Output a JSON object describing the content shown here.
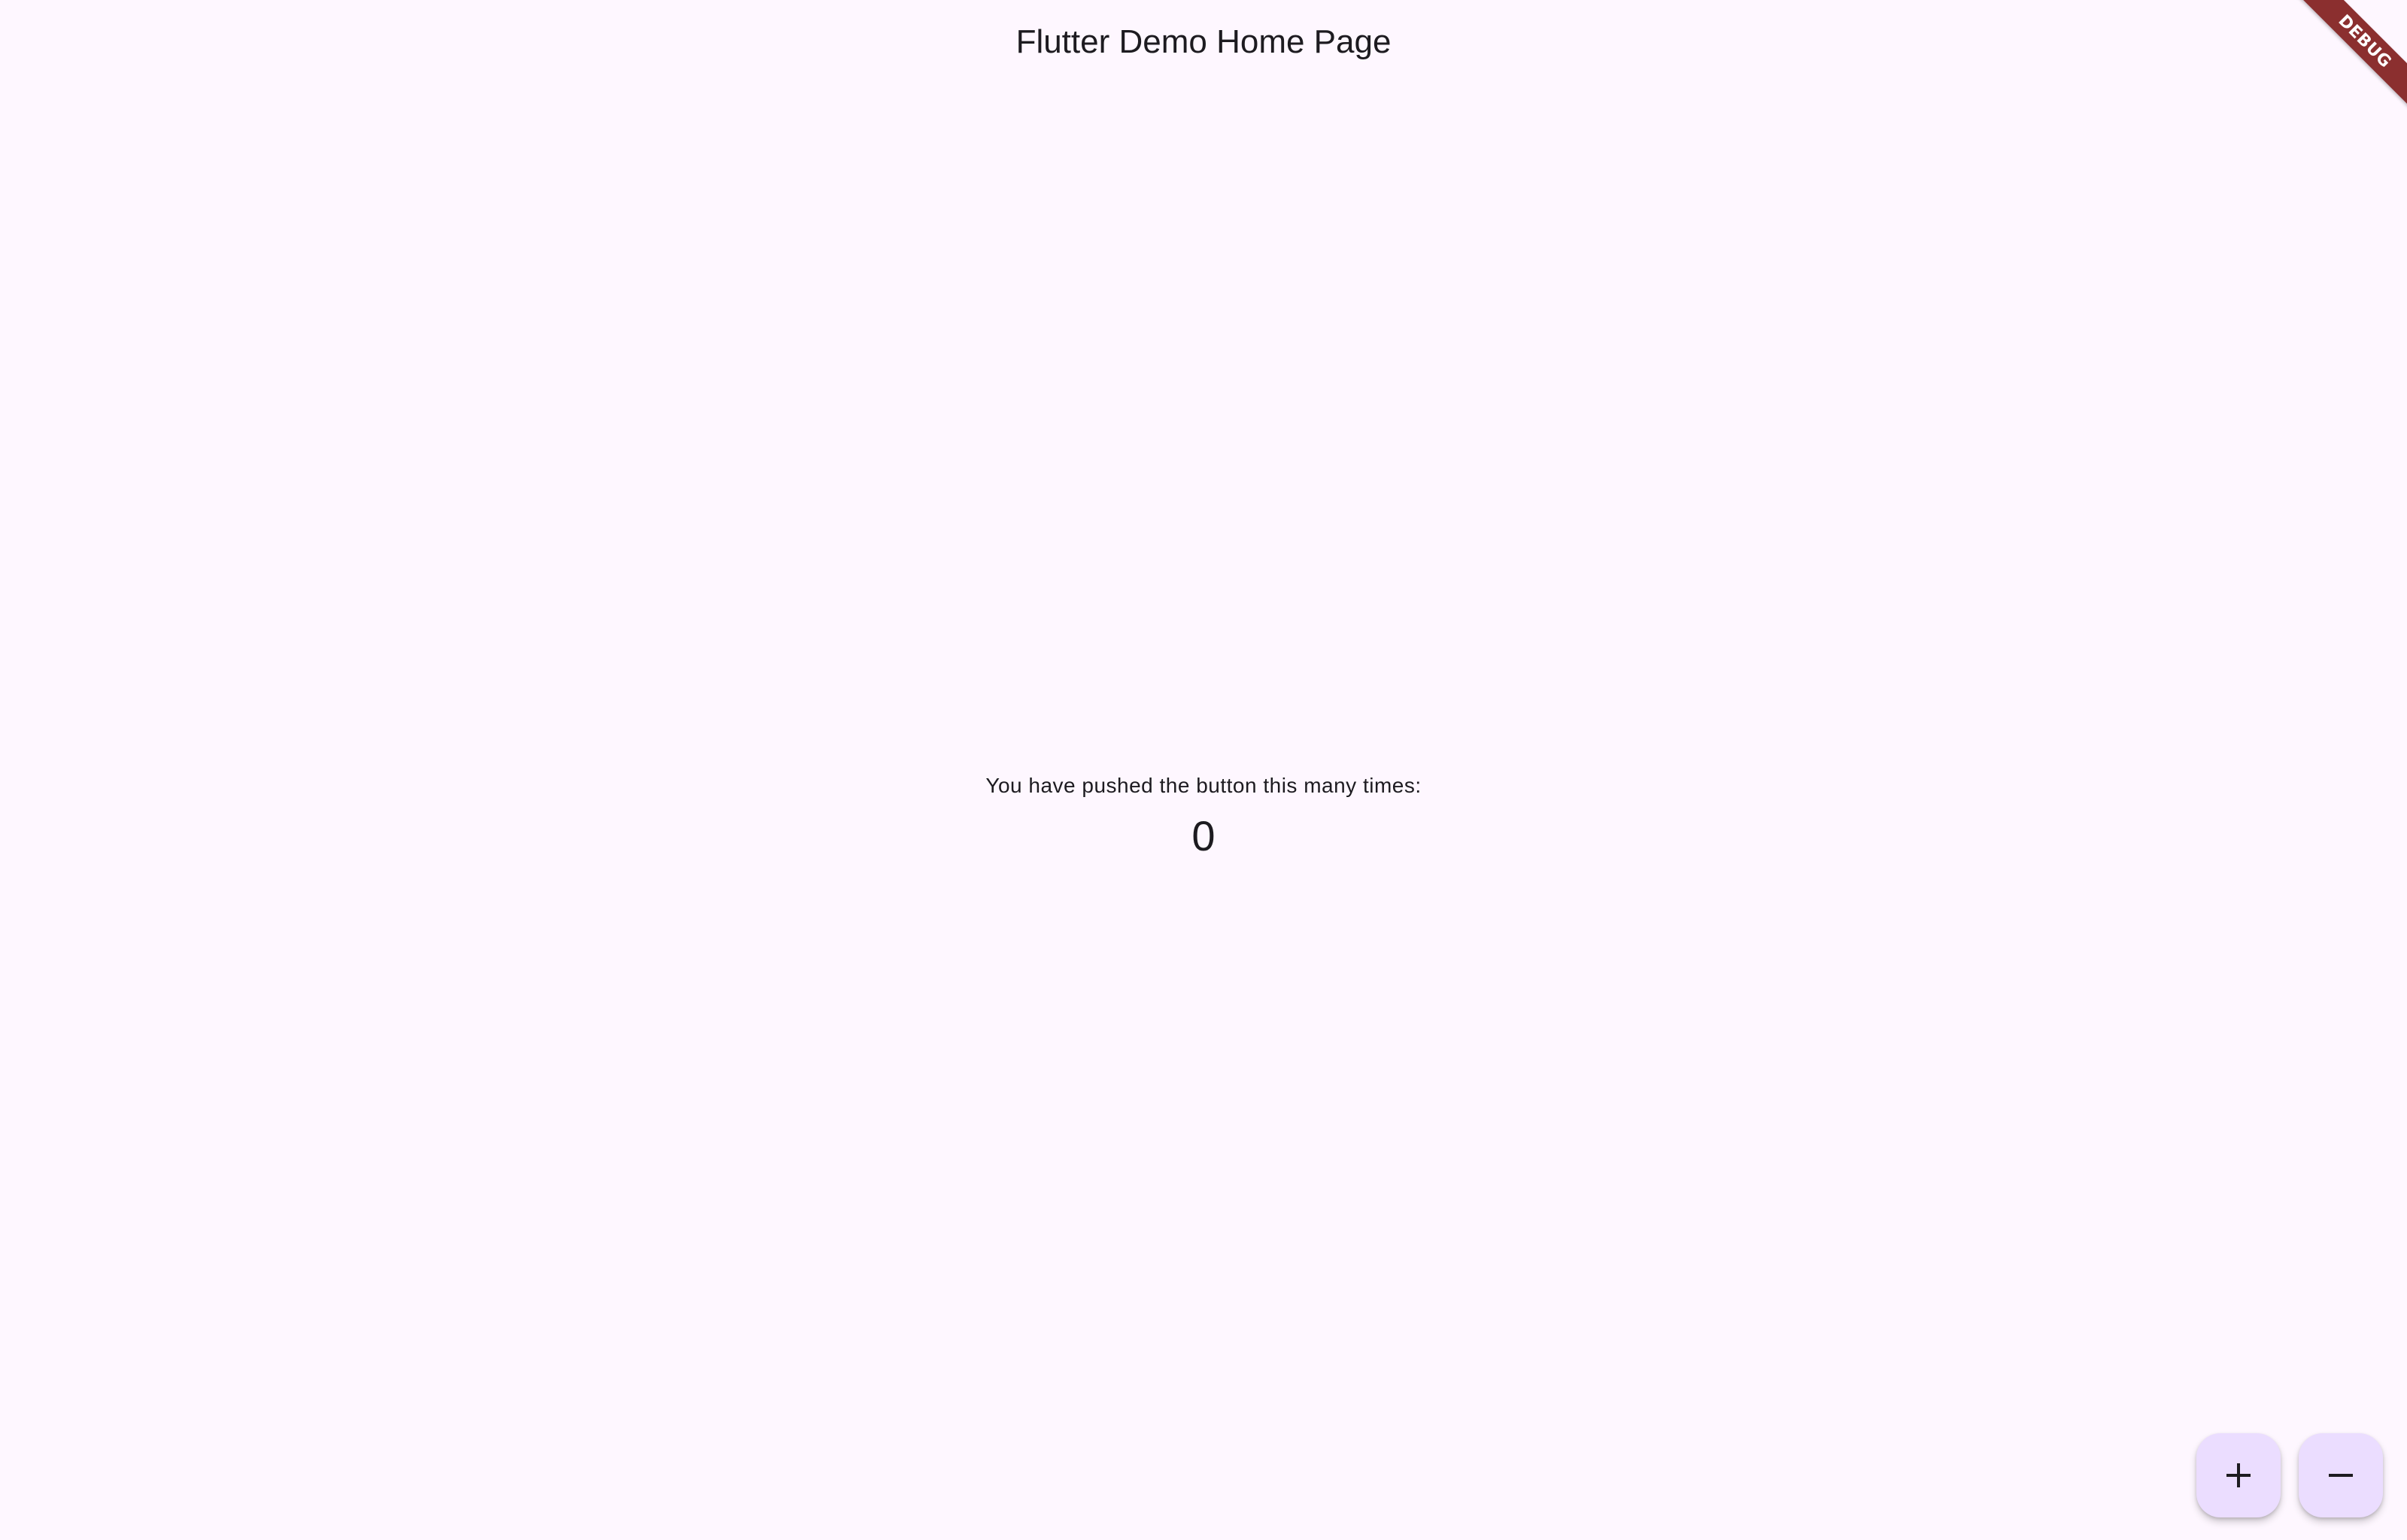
{
  "app_bar": {
    "title": "Flutter Demo Home Page"
  },
  "body": {
    "message": "You have pushed the button this many times:",
    "counter": "0"
  },
  "fabs": {
    "increment_icon": "plus-icon",
    "decrement_icon": "minus-icon"
  },
  "debug_banner": {
    "label": "DEBUG"
  },
  "colors": {
    "background": "#fef7ff",
    "fab_background": "#ebddff",
    "text": "#1d1b20",
    "debug_banner": "#8b2f2f"
  }
}
